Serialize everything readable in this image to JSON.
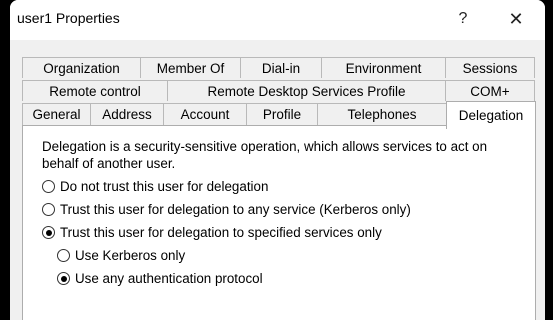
{
  "window": {
    "title": "user1 Properties",
    "help_glyph": "?",
    "close_glyph": "✕"
  },
  "tabs": {
    "row1": [
      "Organization",
      "Member Of",
      "Dial-in",
      "Environment",
      "Sessions"
    ],
    "row2": [
      "Remote control",
      "Remote Desktop Services Profile",
      "COM+"
    ],
    "row3": [
      "General",
      "Address",
      "Account",
      "Profile",
      "Telephones",
      "Delegation"
    ],
    "active": "Delegation"
  },
  "delegation": {
    "description": "Delegation is a security-sensitive operation, which allows services to act on behalf of another user.",
    "options": [
      {
        "label": "Do not trust this user for delegation",
        "checked": false
      },
      {
        "label": "Trust this user for delegation to any service (Kerberos only)",
        "checked": false
      },
      {
        "label": "Trust this user for delegation to specified services only",
        "checked": true
      }
    ],
    "sub_options": [
      {
        "label": "Use Kerberos only",
        "checked": false
      },
      {
        "label": "Use any authentication protocol",
        "checked": true
      }
    ]
  }
}
